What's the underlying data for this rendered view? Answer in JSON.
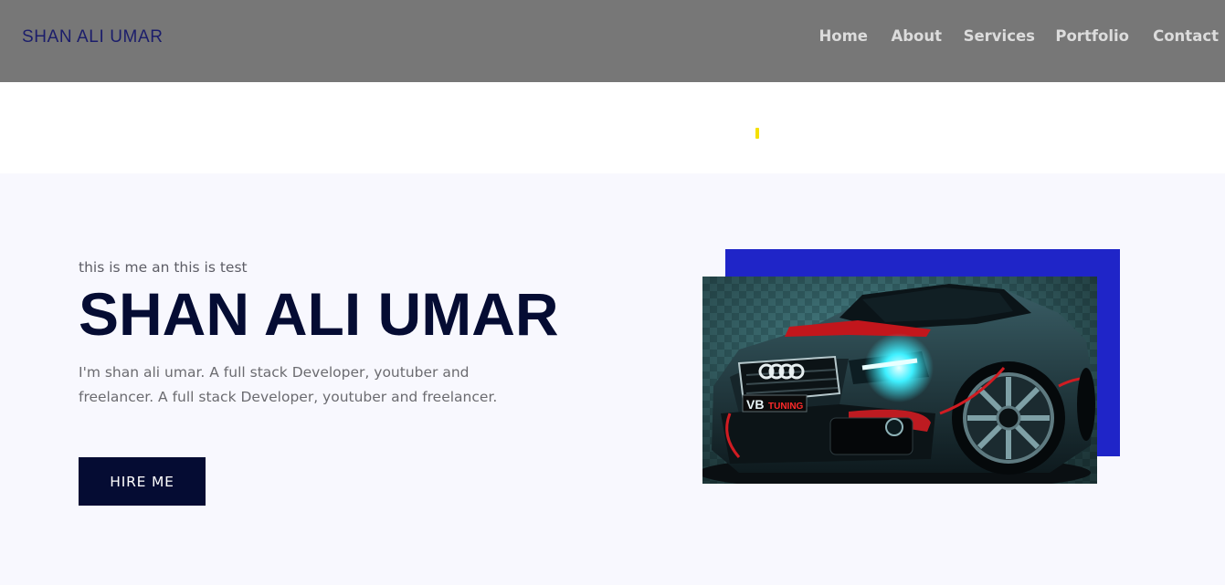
{
  "header": {
    "brand": "SHAN ALI UMAR",
    "nav": [
      "Home",
      "About",
      "Services",
      "Portfolio",
      "Contact"
    ]
  },
  "hero": {
    "eyebrow": "this is me an this is test",
    "title": "SHAN ALI UMAR",
    "bio": "I'm shan ali umar. A full stack Developer, youtuber and freelancer. A full stack Developer, youtuber and freelancer.",
    "cta_label": "HIRE ME",
    "image": {
      "badge_text": "VB TUNING",
      "grille_logo": "audi-rings"
    }
  },
  "colors": {
    "header_bg": "#777777",
    "brand": "#1b1d6b",
    "hero_bg": "#f8f8fe",
    "title": "#050c33",
    "button_bg": "#050c33",
    "accent_block": "#1f25c8",
    "loader": "#f5e000"
  }
}
